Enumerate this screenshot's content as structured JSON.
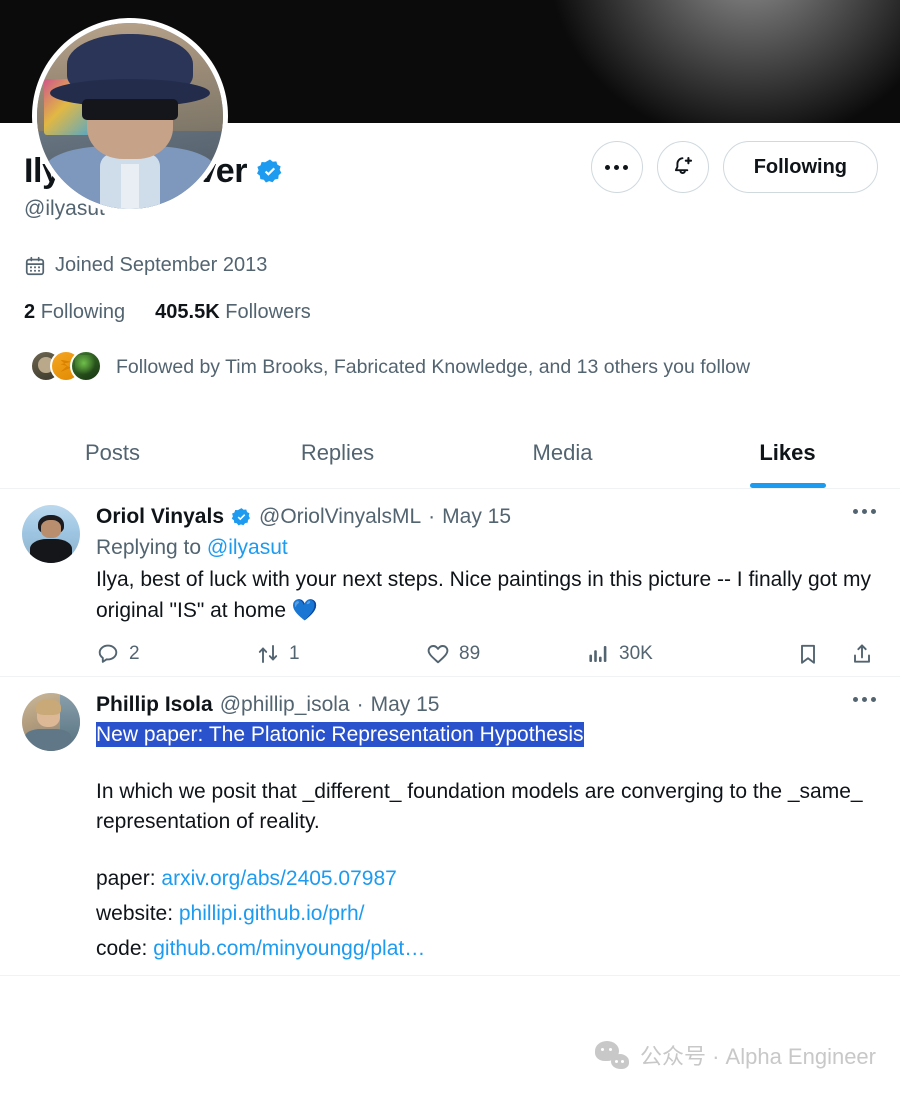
{
  "profile": {
    "display_name": "Ilya Sutskever",
    "verified": true,
    "handle": "@ilyasut",
    "joined": "Joined September 2013",
    "following_count": "2",
    "following_label": "Following",
    "followers_count": "405.5K",
    "followers_label": "Followers",
    "followed_by": "Followed by Tim Brooks, Fabricated Knowledge, and 13 others you follow"
  },
  "header_actions": {
    "more_label": "More",
    "notify_label": "Notify",
    "follow_state": "Following"
  },
  "tabs": [
    {
      "label": "Posts",
      "active": false
    },
    {
      "label": "Replies",
      "active": false
    },
    {
      "label": "Media",
      "active": false
    },
    {
      "label": "Likes",
      "active": true
    }
  ],
  "tweets": [
    {
      "name": "Oriol Vinyals",
      "verified": true,
      "handle": "@OriolVinyalsML",
      "separator": "·",
      "date": "May 15",
      "replying_prefix": "Replying to ",
      "replying_mention": "@ilyasut",
      "text": "Ilya, best of luck with your next steps. Nice paintings in this picture -- I finally got my original \"IS\" at home ",
      "emoji": "💙",
      "actions": {
        "replies": "2",
        "retweets": "1",
        "likes": "89",
        "views": "30K"
      }
    },
    {
      "name": "Phillip Isola",
      "verified": false,
      "handle": "@phillip_isola",
      "separator": "·",
      "date": "May 15",
      "highlighted_line": "New paper: The Platonic Representation Hypothesis",
      "body_line_1": "In which we posit that _different_ foundation models are converging to the _same_ representation of reality.",
      "link_rows": [
        {
          "label": "paper: ",
          "url": "arxiv.org/abs/2405.07987"
        },
        {
          "label": "website: ",
          "url": "phillipi.github.io/prh/"
        },
        {
          "label": "code: ",
          "url": "github.com/minyoungg/plat…"
        }
      ]
    }
  ],
  "watermark": {
    "text": "公众号 · Alpha Engineer"
  },
  "colors": {
    "accent": "#1d9bf0",
    "verified": "#1d9bf0",
    "selection": "#2952cc",
    "muted": "#536471",
    "text": "#0f1419",
    "border": "#eff3f4"
  }
}
